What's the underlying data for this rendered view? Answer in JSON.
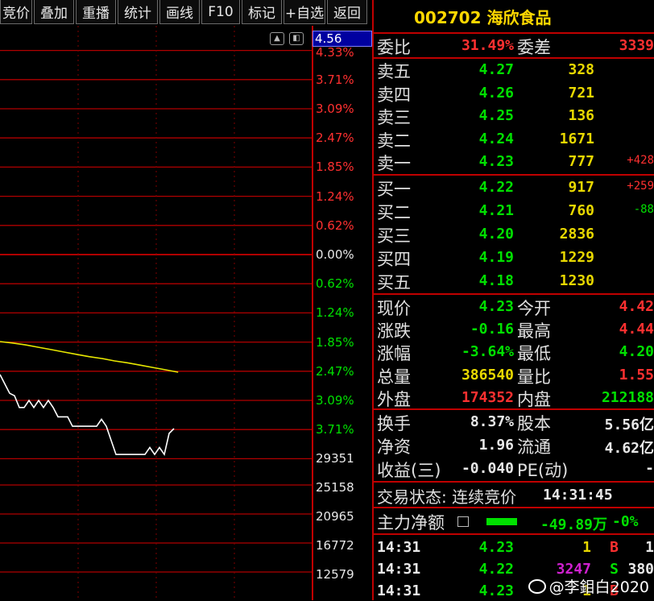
{
  "toolbar": [
    "竞价",
    "叠加",
    "重播",
    "统计",
    "画线",
    "F10",
    "标记",
    "+自选",
    "返回"
  ],
  "chart": {
    "cursor_value": "4.56",
    "pct_labels": [
      {
        "text": "4.33%",
        "c": "red"
      },
      {
        "text": "3.71%",
        "c": "red"
      },
      {
        "text": "3.09%",
        "c": "red"
      },
      {
        "text": "2.47%",
        "c": "red"
      },
      {
        "text": "1.85%",
        "c": "red"
      },
      {
        "text": "1.24%",
        "c": "red"
      },
      {
        "text": "0.62%",
        "c": "red"
      },
      {
        "text": "0.00%",
        "c": "white"
      },
      {
        "text": "0.62%",
        "c": "green"
      },
      {
        "text": "1.24%",
        "c": "green"
      },
      {
        "text": "1.85%",
        "c": "green"
      },
      {
        "text": "2.47%",
        "c": "green"
      },
      {
        "text": "3.09%",
        "c": "green"
      },
      {
        "text": "3.71%",
        "c": "green"
      }
    ],
    "vol_labels": [
      "29351",
      "25158",
      "20965",
      "16772",
      "12579"
    ],
    "icons": [
      "arrow-up-icon",
      "panel-toggle-icon"
    ]
  },
  "chart_data": {
    "type": "line",
    "series": [
      {
        "color": "#e8e800",
        "values": [
          1.85,
          1.88,
          1.92,
          1.97,
          2.02,
          2.07,
          2.12,
          2.17,
          2.21,
          2.26,
          2.3,
          2.35,
          2.4,
          2.45,
          2.5
        ]
      },
      {
        "color": "#ffffff",
        "values": [
          2.55,
          2.75,
          2.95,
          3.0,
          3.25,
          3.25,
          3.1,
          3.25,
          3.1,
          3.25,
          3.1,
          3.25,
          3.45,
          3.45,
          3.45,
          3.65,
          3.65,
          3.65,
          3.65,
          3.65,
          3.65,
          3.5,
          3.65,
          3.95,
          4.25,
          4.25,
          4.25,
          4.25,
          4.25,
          4.25,
          4.25,
          4.1,
          4.25,
          4.1,
          4.25,
          3.8,
          3.7
        ]
      }
    ]
  },
  "quote": {
    "title": "002702 海欣食品",
    "weibi_label": "委比",
    "weibi_value": "31.49%",
    "weicha_label": "委差",
    "weicha_value": "3339",
    "sells": [
      {
        "label": "卖五",
        "price": "4.27",
        "vol": "328",
        "chg": ""
      },
      {
        "label": "卖四",
        "price": "4.26",
        "vol": "721",
        "chg": ""
      },
      {
        "label": "卖三",
        "price": "4.25",
        "vol": "136",
        "chg": ""
      },
      {
        "label": "卖二",
        "price": "4.24",
        "vol": "1671",
        "chg": ""
      },
      {
        "label": "卖一",
        "price": "4.23",
        "vol": "777",
        "chg": "+428"
      }
    ],
    "buys": [
      {
        "label": "买一",
        "price": "4.22",
        "vol": "917",
        "chg": "+259",
        "chgc": "red"
      },
      {
        "label": "买二",
        "price": "4.21",
        "vol": "760",
        "chg": "-88",
        "chgc": "green"
      },
      {
        "label": "买三",
        "price": "4.20",
        "vol": "2836",
        "chg": ""
      },
      {
        "label": "买四",
        "price": "4.19",
        "vol": "1229",
        "chg": ""
      },
      {
        "label": "买五",
        "price": "4.18",
        "vol": "1230",
        "chg": ""
      }
    ],
    "stats": [
      {
        "l1": "现价",
        "v1": "4.23",
        "c1": "green",
        "l2": "今开",
        "v2": "4.42",
        "c2": "red"
      },
      {
        "l1": "涨跌",
        "v1": "-0.16",
        "c1": "green",
        "l2": "最高",
        "v2": "4.44",
        "c2": "red"
      },
      {
        "l1": "涨幅",
        "v1": "-3.64%",
        "c1": "green",
        "l2": "最低",
        "v2": "4.20",
        "c2": "green"
      },
      {
        "l1": "总量",
        "v1": "386540",
        "c1": "yellow",
        "l2": "量比",
        "v2": "1.55",
        "c2": "red"
      },
      {
        "l1": "外盘",
        "v1": "174352",
        "c1": "red",
        "l2": "内盘",
        "v2": "212188",
        "c2": "green"
      }
    ],
    "stats2": [
      {
        "l1": "换手",
        "v1": "8.37%",
        "l2": "股本",
        "v2": "5.56亿"
      },
      {
        "l1": "净资",
        "v1": "1.96",
        "l2": "流通",
        "v2": "4.62亿"
      },
      {
        "l1": "收益(三)",
        "v1": "-0.040",
        "l2": "PE(动)",
        "v2": "-"
      }
    ],
    "status_label": "交易状态: 连续竞价",
    "status_time": "14:31:45",
    "main_flow_label": "主力净额",
    "main_flow_value": "-49.89万",
    "main_flow_pct": "-0%",
    "ticks": [
      {
        "time": "14:31",
        "price": "4.23",
        "vol": "1",
        "volc": "yellow",
        "dir": "B",
        "dirc": "red",
        "n": "1"
      },
      {
        "time": "14:31",
        "price": "4.22",
        "vol": "3247",
        "volc": "magenta",
        "dir": "S",
        "dirc": "green",
        "n": "380"
      },
      {
        "time": "14:31",
        "price": "4.23",
        "vol": "1",
        "volc": "yellow",
        "dir": "B",
        "dirc": "red",
        "n": ""
      }
    ],
    "watermark": "@李鉬白2020"
  }
}
